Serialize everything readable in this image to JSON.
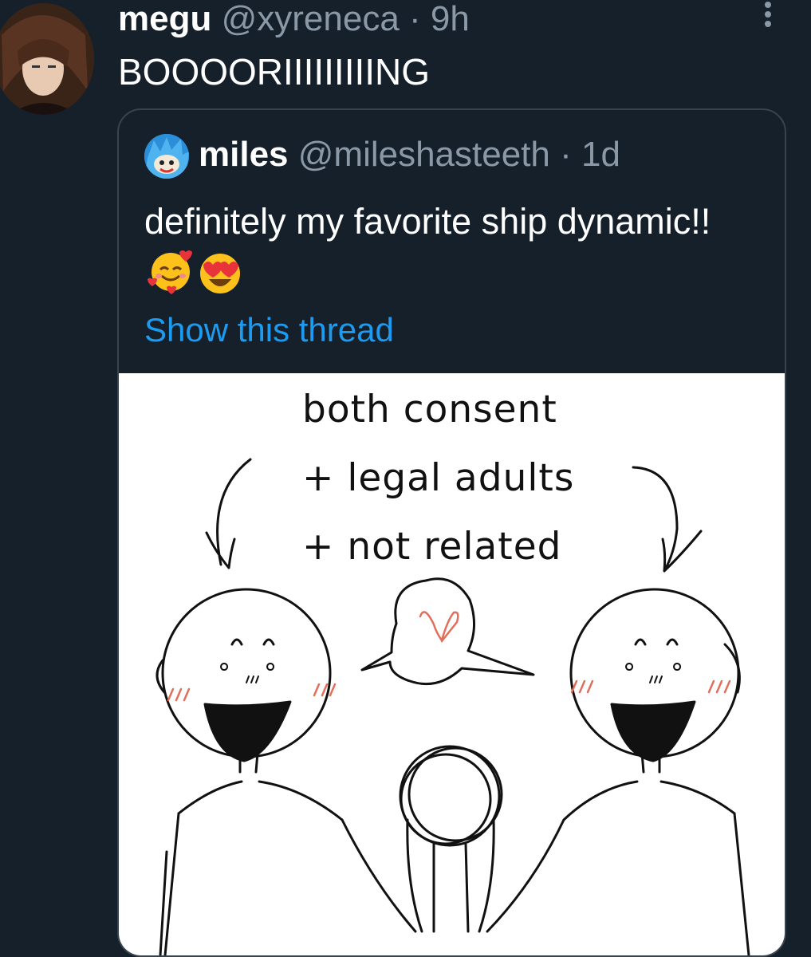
{
  "tweet": {
    "display_name": "megu",
    "handle": "@xyreneca",
    "time_sep": "·",
    "time": "9h",
    "text": "BOOOORIIIIIIIIING",
    "avatar_icon": "anime-character-avatar"
  },
  "quoted_tweet": {
    "display_name": "miles",
    "handle": "@mileshasteeth",
    "time_sep": "·",
    "time": "1d",
    "text": "definitely my favorite ship dynamic!!",
    "emojis": [
      "smiling-face-with-hearts-icon",
      "heart-eyes-icon"
    ],
    "show_thread": "Show this thread",
    "avatar_icon": "cartoon-avatar"
  },
  "media": {
    "caption_line_1": "both consent",
    "caption_line_2": "+ legal adults",
    "caption_line_3": "+ not related"
  },
  "colors": {
    "background": "#15202b",
    "secondary_text": "#8b98a5",
    "link": "#1d9bf0",
    "border": "#38444d"
  }
}
